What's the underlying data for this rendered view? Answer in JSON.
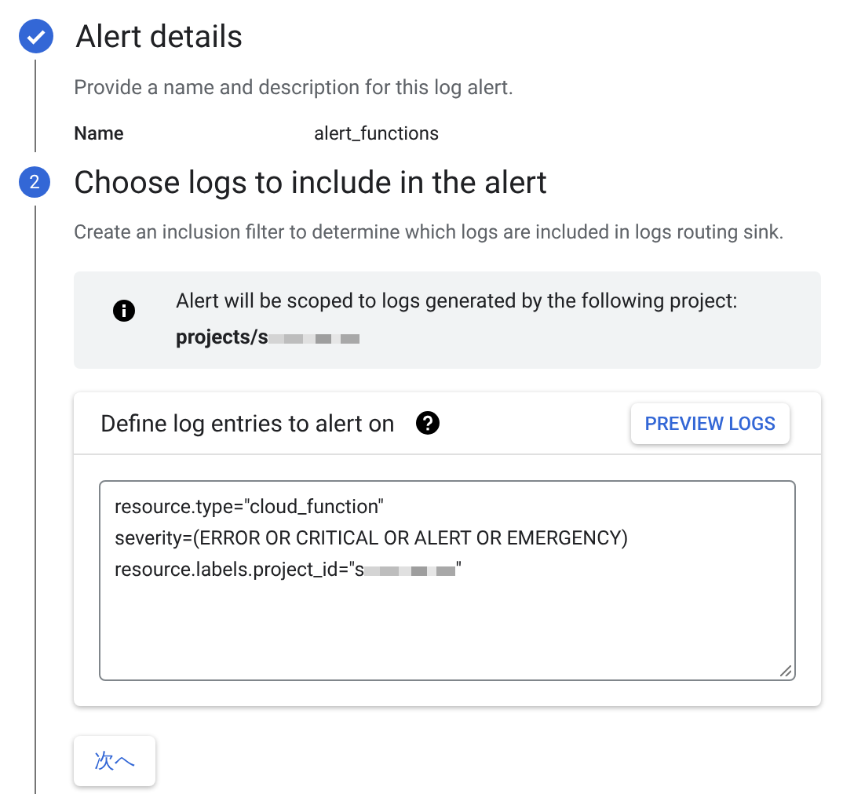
{
  "steps": [
    {
      "kind": "done",
      "title": "Alert details",
      "description": "Provide a name and description for this log alert.",
      "fields": [
        {
          "label": "Name",
          "value": "alert_functions"
        }
      ]
    },
    {
      "kind": "current",
      "number": "2",
      "title": "Choose logs to include in the alert",
      "description": "Create an inclusion filter to determine which logs are included in logs routing sink."
    }
  ],
  "notice": {
    "text": "Alert will be scoped to logs generated by the following project:",
    "project": "projects/s",
    "project_redacted": true
  },
  "query_card": {
    "title": "Define log entries to alert on",
    "preview_button": "PREVIEW LOGS",
    "filter_lines": [
      {
        "text": "resource.type=\"cloud_function\"",
        "redacted": false
      },
      {
        "text": "severity=(ERROR OR CRITICAL OR ALERT OR EMERGENCY)",
        "redacted": false
      },
      {
        "text": "resource.labels.project_id=\"s",
        "redacted": true,
        "after": "\""
      }
    ]
  },
  "next_button": "次へ"
}
